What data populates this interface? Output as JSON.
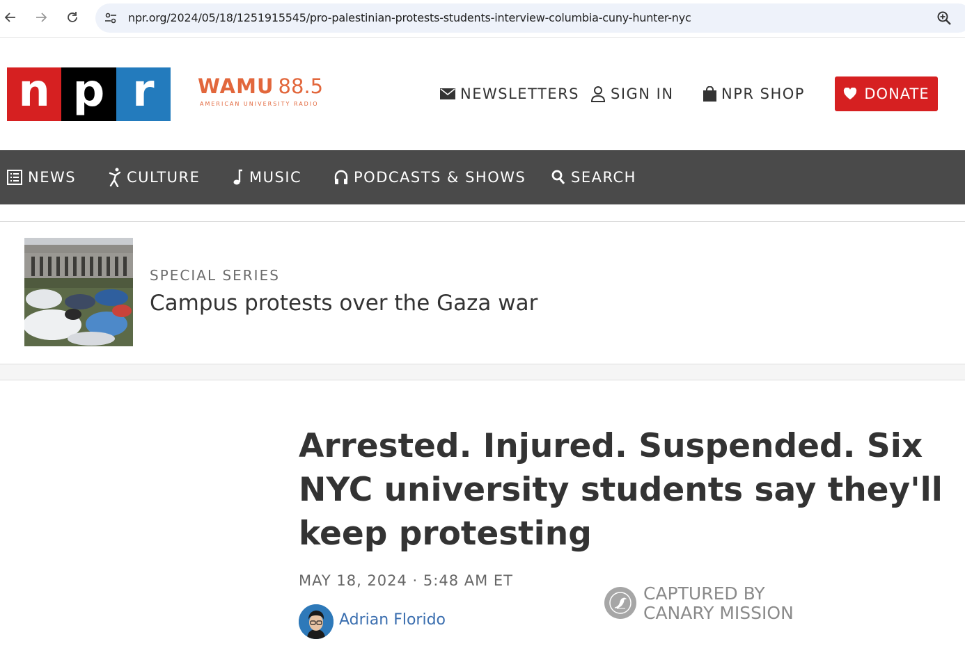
{
  "browser": {
    "url": "npr.org/2024/05/18/1251915545/pro-palestinian-protests-students-interview-columbia-cuny-hunter-nyc",
    "back_icon": "arrow-left-icon",
    "forward_icon": "arrow-right-icon",
    "reload_icon": "reload-icon",
    "site_settings_icon": "tune-icon",
    "zoom_icon": "zoom-in-icon"
  },
  "header": {
    "logo": {
      "n": "n",
      "p": "p",
      "r": "r"
    },
    "station": {
      "name": "WAMU",
      "frequency": "88.5",
      "tagline": "AMERICAN UNIVERSITY RADIO"
    },
    "links": [
      {
        "label": "NEWSLETTERS",
        "icon": "envelope-icon"
      },
      {
        "label": "SIGN IN",
        "icon": "user-icon"
      },
      {
        "label": "NPR SHOP",
        "icon": "shopping-bag-icon"
      }
    ],
    "donate": {
      "label": "DONATE",
      "icon": "heart-icon"
    }
  },
  "section_nav": [
    {
      "label": "NEWS",
      "icon": "newspaper-icon"
    },
    {
      "label": "CULTURE",
      "icon": "dancer-icon"
    },
    {
      "label": "MUSIC",
      "icon": "music-note-icon"
    },
    {
      "label": "PODCASTS & SHOWS",
      "icon": "headphones-icon"
    },
    {
      "label": "SEARCH",
      "icon": "search-icon"
    }
  ],
  "series": {
    "label": "SPECIAL SERIES",
    "title": "Campus protests over the Gaza war"
  },
  "article": {
    "headline": "Arrested. Injured. Suspended. Six NYC university students say they'll keep protesting",
    "dateline": "MAY 18, 2024 · 5:48 AM ET",
    "author": "Adrian Florido"
  },
  "stamp": {
    "line1": "CAPTURED BY",
    "line2": "CANARY MISSION",
    "icon": "canary-bird-icon"
  },
  "colors": {
    "npr_red": "#d62021",
    "npr_black": "#000000",
    "npr_blue": "#237bbd",
    "wamu_orange": "#e2673c",
    "nav_bg": "#4a4a4a",
    "author_link": "#3a6eaf"
  }
}
